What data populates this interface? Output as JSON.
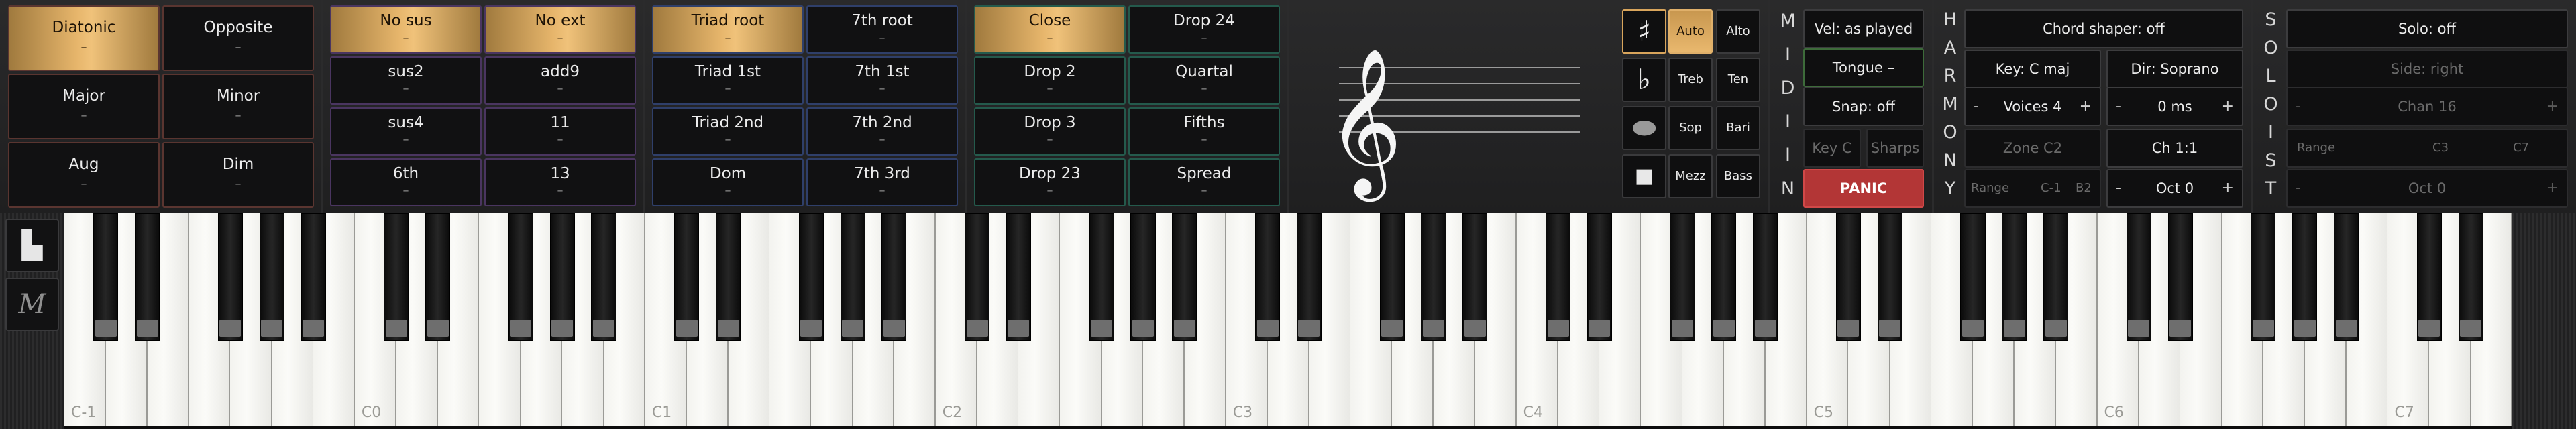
{
  "panel1": [
    {
      "label": "Diatonic",
      "sub": "–",
      "active": true
    },
    {
      "label": "Opposite",
      "sub": "–",
      "active": false
    },
    {
      "label": "Major",
      "sub": "–",
      "active": false
    },
    {
      "label": "Minor",
      "sub": "–",
      "active": false
    },
    {
      "label": "Aug",
      "sub": "–",
      "active": false
    },
    {
      "label": "Dim",
      "sub": "–",
      "active": false
    }
  ],
  "panel2": [
    {
      "label": "No sus",
      "sub": "–",
      "active": true
    },
    {
      "label": "No ext",
      "sub": "–",
      "active": true
    },
    {
      "label": "sus2",
      "sub": "–",
      "active": false
    },
    {
      "label": "add9",
      "sub": "–",
      "active": false
    },
    {
      "label": "sus4",
      "sub": "–",
      "active": false
    },
    {
      "label": "11",
      "sub": "–",
      "active": false
    },
    {
      "label": "6th",
      "sub": "–",
      "active": false
    },
    {
      "label": "13",
      "sub": "–",
      "active": false
    }
  ],
  "panel3": [
    {
      "label": "Triad root",
      "sub": "–",
      "active": true
    },
    {
      "label": "7th root",
      "sub": "–",
      "active": false
    },
    {
      "label": "Triad 1st",
      "sub": "–",
      "active": false
    },
    {
      "label": "7th 1st",
      "sub": "–",
      "active": false
    },
    {
      "label": "Triad 2nd",
      "sub": "–",
      "active": false
    },
    {
      "label": "7th 2nd",
      "sub": "–",
      "active": false
    },
    {
      "label": "Dom",
      "sub": "–",
      "active": false
    },
    {
      "label": "7th 3rd",
      "sub": "–",
      "active": false
    }
  ],
  "panel4": [
    {
      "label": "Close",
      "sub": "–",
      "active": true
    },
    {
      "label": "Drop 24",
      "sub": "–",
      "active": false
    },
    {
      "label": "Drop 2",
      "sub": "–",
      "active": false
    },
    {
      "label": "Quartal",
      "sub": "–",
      "active": false
    },
    {
      "label": "Drop 3",
      "sub": "–",
      "active": false
    },
    {
      "label": "Fifths",
      "sub": "–",
      "active": false
    },
    {
      "label": "Drop 23",
      "sub": "–",
      "active": false
    },
    {
      "label": "Spread",
      "sub": "–",
      "active": false
    }
  ],
  "notation": {
    "clef_glyph": "𝄞",
    "sharp_glyph": "♯",
    "flat_glyph": "♭",
    "note_glyph": "⬬",
    "square_glyph": "■",
    "auto": "Auto",
    "alto": "Alto",
    "treb": "Treb",
    "ten": "Ten",
    "sop": "Sop",
    "bari": "Bari",
    "mezz": "Mezz",
    "bass": "Bass"
  },
  "midi_in": {
    "label_letters": [
      "M",
      "I",
      "D",
      "I",
      "I",
      "N"
    ],
    "velocity": "Vel: as played",
    "tongue": "Tongue –",
    "snap": "Snap: off",
    "key_c": "Key C",
    "sharps": "Sharps",
    "panic": "PANIC"
  },
  "harmony": {
    "label_letters": [
      "H",
      "A",
      "R",
      "M",
      "O",
      "N",
      "Y"
    ],
    "chord_shaper": "Chord shaper: off",
    "key": "Key: C maj",
    "dir": "Dir: Soprano",
    "voices": "Voices 4",
    "delay": "0 ms",
    "zone": "Zone C2",
    "channel": "Ch 1:1",
    "range_label": "Range",
    "range_low": "C-1",
    "range_high": "B2",
    "octave": "Oct 0",
    "minus": "-",
    "plus": "+"
  },
  "soloist": {
    "label_letters": [
      "S",
      "O",
      "L",
      "O",
      "I",
      "S",
      "T"
    ],
    "solo": "Solo: off",
    "side": "Side: right",
    "channel": "Chan 16",
    "range_label": "Range",
    "range_low": "C3",
    "range_high": "C7",
    "octave": "Oct 0",
    "minus": "-",
    "plus": "+"
  },
  "sidebar": {
    "keyboard_icon": "▙",
    "m_label": "M"
  },
  "keyboard": {
    "octave_labels": [
      "C-1",
      "C0",
      "C1",
      "C2",
      "C3",
      "C4",
      "C5",
      "C6",
      "C7"
    ]
  }
}
